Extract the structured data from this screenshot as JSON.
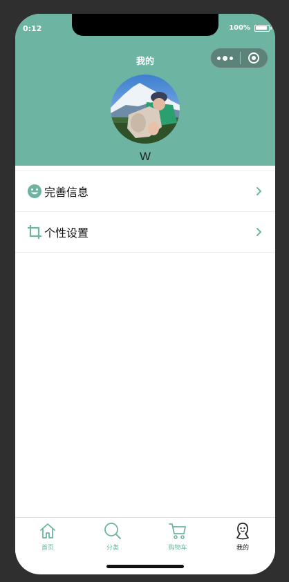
{
  "status_bar": {
    "time": "0:12",
    "battery": "100%"
  },
  "header": {
    "title": "我的",
    "username": "W"
  },
  "menu": {
    "items": [
      {
        "label": "完善信息",
        "icon": "smiley-icon"
      },
      {
        "label": "个性设置",
        "icon": "crop-icon"
      }
    ]
  },
  "tabbar": {
    "tabs": [
      {
        "label": "首页",
        "icon": "home-icon",
        "active": false
      },
      {
        "label": "分类",
        "icon": "search-icon",
        "active": false
      },
      {
        "label": "购物车",
        "icon": "cart-icon",
        "active": false
      },
      {
        "label": "我的",
        "icon": "user-icon",
        "active": true
      }
    ]
  },
  "colors": {
    "accent": "#6db5a2",
    "background": "#ffffff",
    "frame": "#2f2f2f"
  }
}
